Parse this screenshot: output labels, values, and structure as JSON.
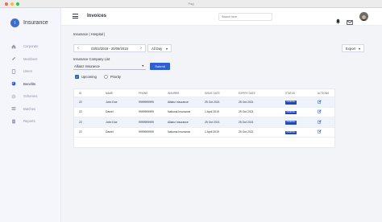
{
  "browser": {
    "title": "Pag",
    "dot_colors": [
      "#ff5f57",
      "#febc2e",
      "#28c840"
    ]
  },
  "brand": {
    "initial": "I",
    "name": "Insurance",
    "accent": "#3b6fd6"
  },
  "sidebar": {
    "items": [
      {
        "label": "Corporate",
        "icon": "home-icon",
        "active": false
      },
      {
        "label": "Members",
        "icon": "pencil-icon",
        "active": false
      },
      {
        "label": "Users",
        "icon": "document-icon",
        "active": false
      },
      {
        "label": "Benefits",
        "icon": "pie-chart-icon",
        "active": true
      },
      {
        "label": "Schemes",
        "icon": "settings-icon",
        "active": false
      },
      {
        "label": "Batches",
        "icon": "stack-icon",
        "active": false
      },
      {
        "label": "Reports",
        "icon": "report-icon",
        "active": false
      }
    ]
  },
  "header": {
    "title": "Invoices",
    "search_placeholder": "Search here"
  },
  "breadcrumb": "Insurance | Hospital |",
  "filters": {
    "date_range": "03/02/2019 - 20/08/2019",
    "period": "All Day",
    "export_label": "Export",
    "company_label": "Insurance Company List",
    "company_selected": "Allianz Insurance",
    "submit_label": "Submit",
    "options": [
      {
        "label": "Upcoming",
        "checked": true
      },
      {
        "label": "Priority",
        "checked": false
      }
    ]
  },
  "table": {
    "columns": [
      "ID",
      "NAME",
      "PHONE",
      "INSURER",
      "ISSUE DATE",
      "EXPIRY DATE",
      "STATUS",
      "ACTIONS"
    ],
    "rows": [
      {
        "id": "22",
        "name": "John Doe",
        "phone": "9999999999",
        "insurer": "Allianz Insurance",
        "issue": "25 Oct 2021",
        "expiry": "25 Oct 2021",
        "status": "PENDING"
      },
      {
        "id": "22",
        "name": "Daniel",
        "phone": "9999999999",
        "insurer": "National Insurance",
        "issue": "1 April 2019",
        "expiry": "25 Oct 2021",
        "status": "PENDING"
      },
      {
        "id": "22",
        "name": "John Doe",
        "phone": "9999999999",
        "insurer": "Allianz Insurance",
        "issue": "25 Oct 2021",
        "expiry": "25 Oct 2021",
        "status": "PENDING"
      },
      {
        "id": "22",
        "name": "Daniel",
        "phone": "9999999999",
        "insurer": "National Insurance",
        "issue": "1 April 2019",
        "expiry": "25 Oct 2021",
        "status": "PENDING"
      }
    ],
    "status_color": "#1f49b8",
    "highlight_color": "#eef2fb"
  }
}
